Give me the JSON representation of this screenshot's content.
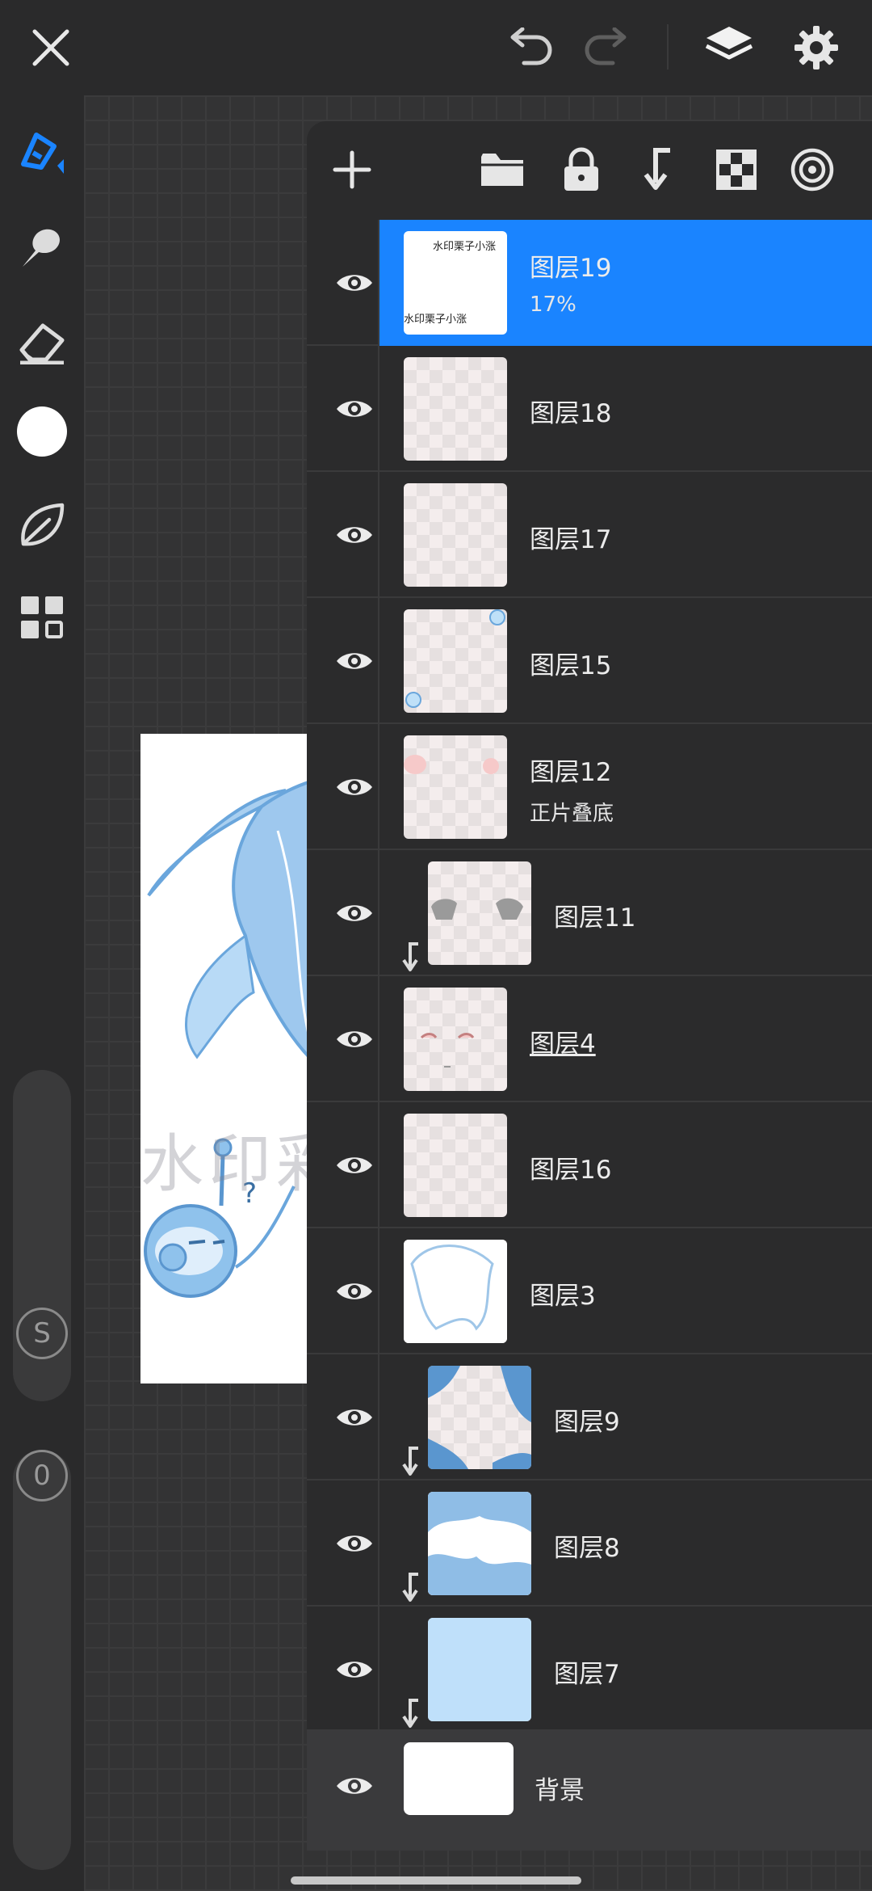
{
  "colors": {
    "accent": "#1a84ff",
    "background": "#2a2a2b",
    "panel": "#2b2b2c",
    "canvas": "#333334"
  },
  "topbar": {
    "close_icon": "close-icon",
    "undo_icon": "undo-icon",
    "redo_icon": "redo-icon",
    "layers_icon": "layers-icon",
    "settings_icon": "gear-icon"
  },
  "left_toolbar": {
    "tools": [
      "brush-icon",
      "smudge-icon",
      "eraser-icon",
      "color-swatch",
      "leaf-icon",
      "grid-icon"
    ],
    "size_label": "S",
    "opacity_label": "0"
  },
  "canvas": {
    "watermark_text": "水印彩"
  },
  "layers_panel": {
    "toolbar": [
      "add-icon",
      "folder-icon",
      "lock-icon",
      "merge-down-icon",
      "checker-icon",
      "target-icon"
    ],
    "layers": [
      {
        "name": "图层19",
        "sub": "17%",
        "active": true,
        "clipped": false,
        "thumb_text_top": "水印栗子小涨",
        "thumb_text_bottom": "水印栗子小涨"
      },
      {
        "name": "图层18",
        "sub": "",
        "active": false,
        "clipped": false
      },
      {
        "name": "图层17",
        "sub": "",
        "active": false,
        "clipped": false
      },
      {
        "name": "图层15",
        "sub": "",
        "active": false,
        "clipped": false
      },
      {
        "name": "图层12",
        "sub": "正片叠底",
        "active": false,
        "clipped": false
      },
      {
        "name": "图层11",
        "sub": "",
        "active": false,
        "clipped": true
      },
      {
        "name": "图层4",
        "sub": "",
        "active": false,
        "clipped": false,
        "underline": true
      },
      {
        "name": "图层16",
        "sub": "",
        "active": false,
        "clipped": false
      },
      {
        "name": "图层3",
        "sub": "",
        "active": false,
        "clipped": false
      },
      {
        "name": "图层9",
        "sub": "",
        "active": false,
        "clipped": true
      },
      {
        "name": "图层8",
        "sub": "",
        "active": false,
        "clipped": true
      },
      {
        "name": "图层7",
        "sub": "",
        "active": false,
        "clipped": true
      }
    ],
    "background_label": "背景"
  }
}
